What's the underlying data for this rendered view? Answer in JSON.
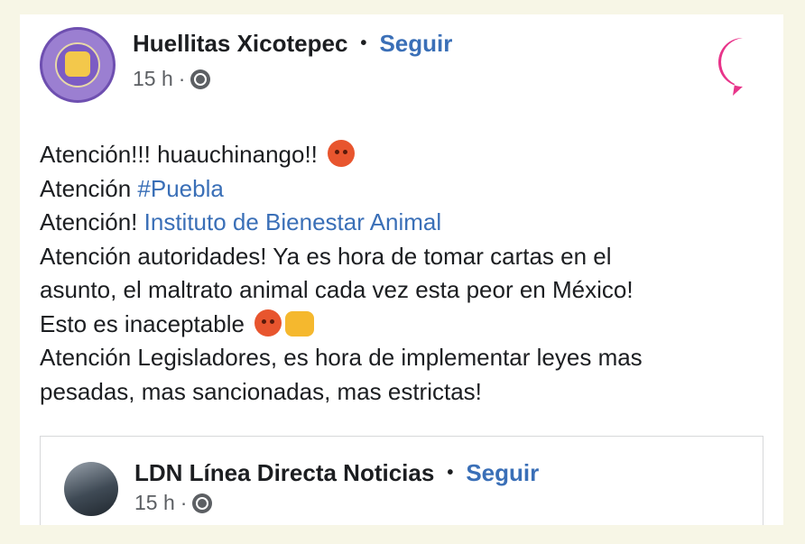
{
  "post": {
    "author": "Huellitas Xicotepec",
    "separator": "•",
    "follow_label": "Seguir",
    "time": "15 h",
    "meta_dot": "·",
    "lines": {
      "l1": "Atención!!! huauchinango!!",
      "l2_prefix": "Atención ",
      "l2_link": "#Puebla",
      "l3_prefix": "Atención! ",
      "l3_link": "Instituto de Bienestar Animal",
      "l4": "Atención autoridades! Ya es hora de tomar cartas en el",
      "l5": "asunto, el maltrato animal cada vez esta peor en México!",
      "l6": "Esto es inaceptable",
      "l7": "Atención Legisladores, es hora de implementar leyes mas",
      "l8": "pesadas, mas sancionadas, mas estrictas!"
    }
  },
  "shared": {
    "author": "LDN Línea Directa Noticias",
    "separator": "•",
    "follow_label": "Seguir",
    "time": "15 h",
    "meta_dot": "·"
  },
  "icons": {
    "privacy": "globe-icon",
    "emoji_angry": "angry-face-icon",
    "emoji_fist": "fist-icon",
    "brand": "brand-logo"
  },
  "colors": {
    "link": "#3a6fb7",
    "brand": "#e8348a",
    "background": "#f7f6e6"
  }
}
